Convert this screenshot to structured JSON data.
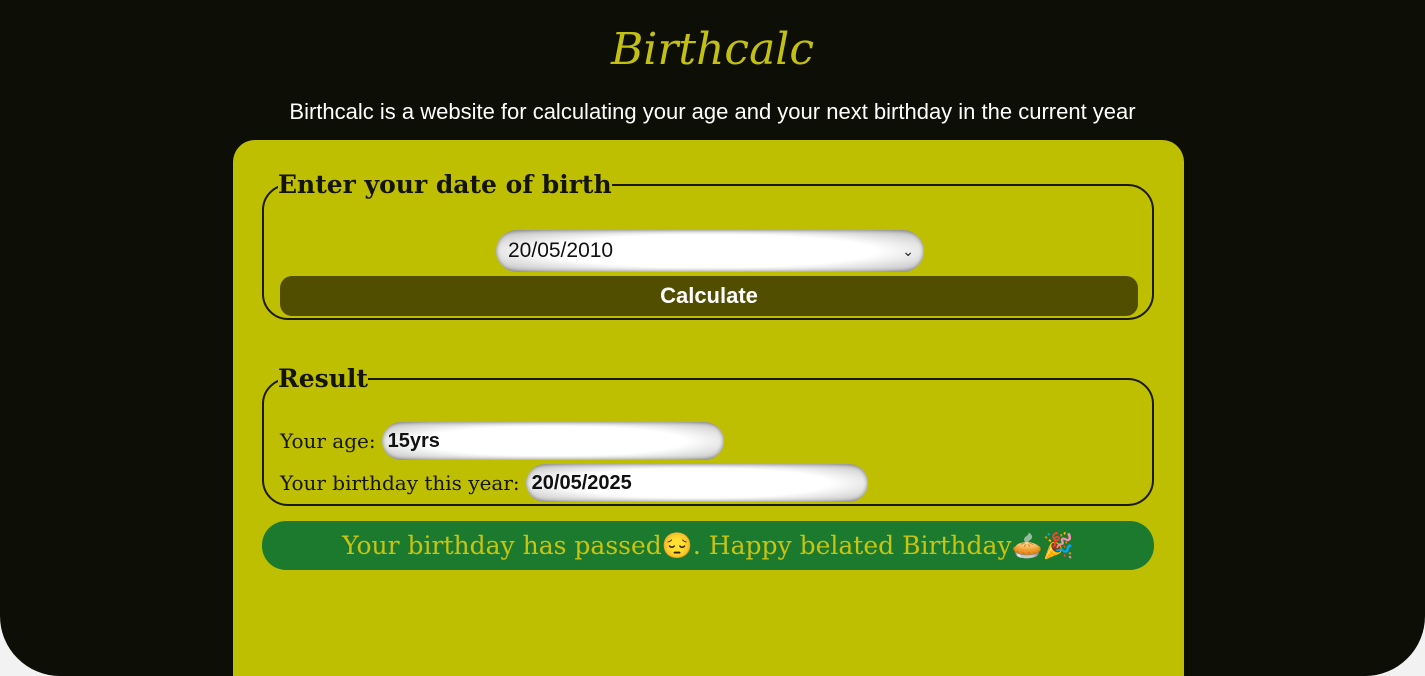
{
  "header": {
    "title": "Birthcalc",
    "subtitle": "Birthcalc is a website for calculating your age and your next birthday in the current year"
  },
  "dob_form": {
    "legend": "Enter your date of birth",
    "date_value": "20/05/2010",
    "chevron_icon": "chevron-down-icon",
    "chevron_glyph": "⌄",
    "calculate_label": "Calculate"
  },
  "result": {
    "legend": "Result",
    "age_label": "Your age:",
    "age_value": "15yrs",
    "birthday_label": "Your birthday this year:",
    "birthday_value": "20/05/2025"
  },
  "message": {
    "text": "Your birthday has passed😔. Happy belated Birthday🥧🎉"
  },
  "colors": {
    "background": "#0d0f07",
    "card": "#bfbf02",
    "accent_title": "#c4c011",
    "button": "#524e00",
    "banner": "#1c7a2e"
  }
}
